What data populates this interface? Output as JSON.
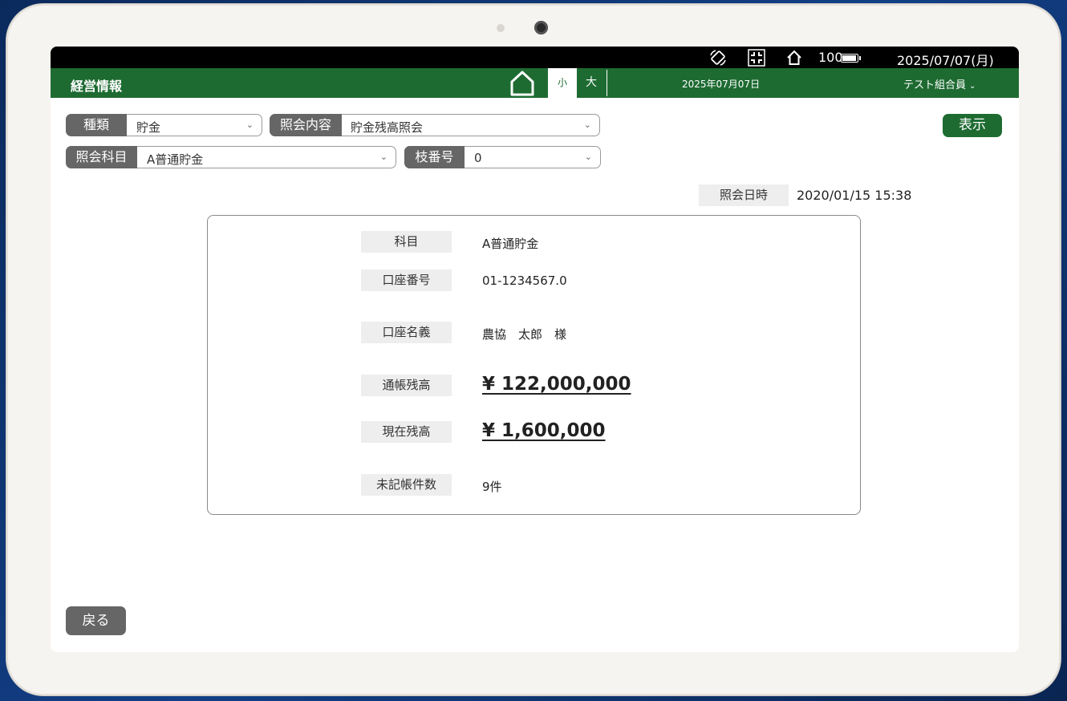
{
  "status_bar": {
    "battery_level": "100",
    "battery_fill": 1.0,
    "datetime": "2025/07/07(月)",
    "icons": [
      "rotate-icon",
      "fullscreen-exit-icon",
      "home-outline-icon",
      "battery-icon"
    ]
  },
  "app_bar": {
    "title": "経営情報",
    "font_small": "小",
    "font_large": "大",
    "date": "2025年07月07日",
    "user": "テスト組合員",
    "user_chevron": "⌄",
    "color": "#1e6b32"
  },
  "filters": {
    "type": {
      "label": "種類",
      "value": "貯金"
    },
    "inquiry": {
      "label": "照会内容",
      "value": "貯金残高照会"
    },
    "subject": {
      "label": "照会科目",
      "value": "A普通貯金"
    },
    "branch": {
      "label": "枝番号",
      "value": "0"
    },
    "arrow": "⌄"
  },
  "show_button": "表示",
  "inquiry_time": {
    "label": "照会日時",
    "value": "2020/01/15 15:38"
  },
  "details": [
    {
      "label": "科目",
      "value": "A普通貯金"
    },
    {
      "label": "口座番号",
      "value": "01-1234567.0"
    },
    {
      "label": "口座名義",
      "value": "農協　太郎　様"
    },
    {
      "label": "通帳残高",
      "value": "¥ 122,000,000"
    },
    {
      "label": "現在残高",
      "value": "¥ 1,600,000"
    },
    {
      "label": "未記帳件数",
      "value": "9件"
    }
  ],
  "back_button": "戻る"
}
